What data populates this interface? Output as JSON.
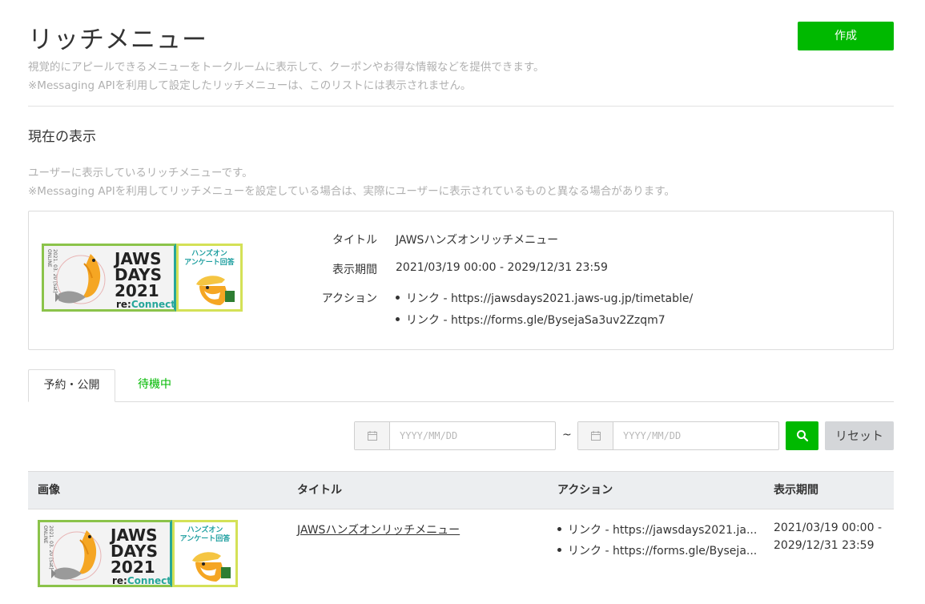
{
  "header": {
    "title": "リッチメニュー",
    "create_label": "作成",
    "desc_line1": "視覚的にアピールできるメニューをトークルームに表示して、クーポンやお得な情報などを提供できます。",
    "desc_line2": "※Messaging APIを利用して設定したリッチメニューは、このリストには表示されません。"
  },
  "current": {
    "heading": "現在の表示",
    "desc_line1": "ユーザーに表示しているリッチメニューです。",
    "desc_line2": "※Messaging APIを利用してリッチメニューを設定している場合は、実際にユーザーに表示されているものと異なる場合があります。",
    "title_label": "タイトル",
    "title_value": "JAWSハンズオンリッチメニュー",
    "period_label": "表示期間",
    "period_value": "2021/03/19 00:00 - 2029/12/31 23:59",
    "action_label": "アクション",
    "actions": [
      "リンク - https://jawsdays2021.jaws-ug.jp/timetable/",
      "リンク - https://forms.gle/BysejaSa3uv2Zzqm7"
    ]
  },
  "banner": {
    "jaws": "JAWS",
    "days": "DAYS",
    "year": "2021",
    "re": "re:",
    "connect": "Connect",
    "date_vertical": "2021. 03. 20 [Sat] ONLINE",
    "hands_on_line1": "ハンズオン",
    "hands_on_line2": "アンケート回答"
  },
  "tabs": [
    {
      "label": "予約・公開",
      "active": true
    },
    {
      "label": "待機中",
      "active": false
    }
  ],
  "filter": {
    "start_placeholder": "YYYY/MM/DD",
    "end_placeholder": "YYYY/MM/DD",
    "separator": "~",
    "reset_label": "リセット"
  },
  "table": {
    "headers": [
      "画像",
      "タイトル",
      "アクション",
      "表示期間"
    ],
    "rows": [
      {
        "title": "JAWSハンズオンリッチメニュー",
        "actions": [
          "リンク - https://jawsdays2021.ja...",
          "リンク - https://forms.gle/Byseja..."
        ],
        "period_line1": "2021/03/19 00:00 -",
        "period_line2": "2029/12/31 23:59"
      }
    ]
  },
  "colors": {
    "accent": "#00b900",
    "teal": "#26a69a",
    "lime": "#8bc34a",
    "orange": "#f5a623"
  }
}
